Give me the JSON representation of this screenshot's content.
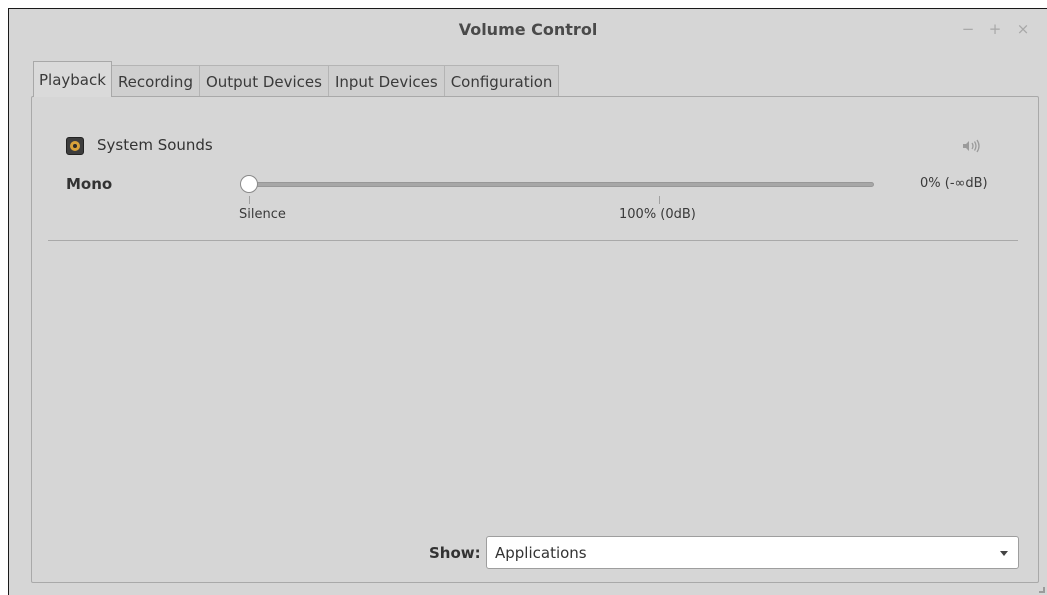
{
  "window": {
    "title": "Volume Control",
    "controls": {
      "minimize": "−",
      "maximize": "+",
      "close": "×"
    }
  },
  "tabs": [
    {
      "label": "Playback",
      "active": true
    },
    {
      "label": "Recording",
      "active": false
    },
    {
      "label": "Output Devices",
      "active": false
    },
    {
      "label": "Input Devices",
      "active": false
    },
    {
      "label": "Configuration",
      "active": false
    }
  ],
  "stream": {
    "icon": "speaker-app-icon",
    "name": "System Sounds",
    "mute_icon": "speaker-volume-icon",
    "channel": "Mono",
    "volume_fraction": 0.0,
    "volume_display": "0% (-∞dB)",
    "marks": {
      "silence": "Silence",
      "normal": "100% (0dB)"
    }
  },
  "show": {
    "label": "Show:",
    "selected": "Applications"
  }
}
